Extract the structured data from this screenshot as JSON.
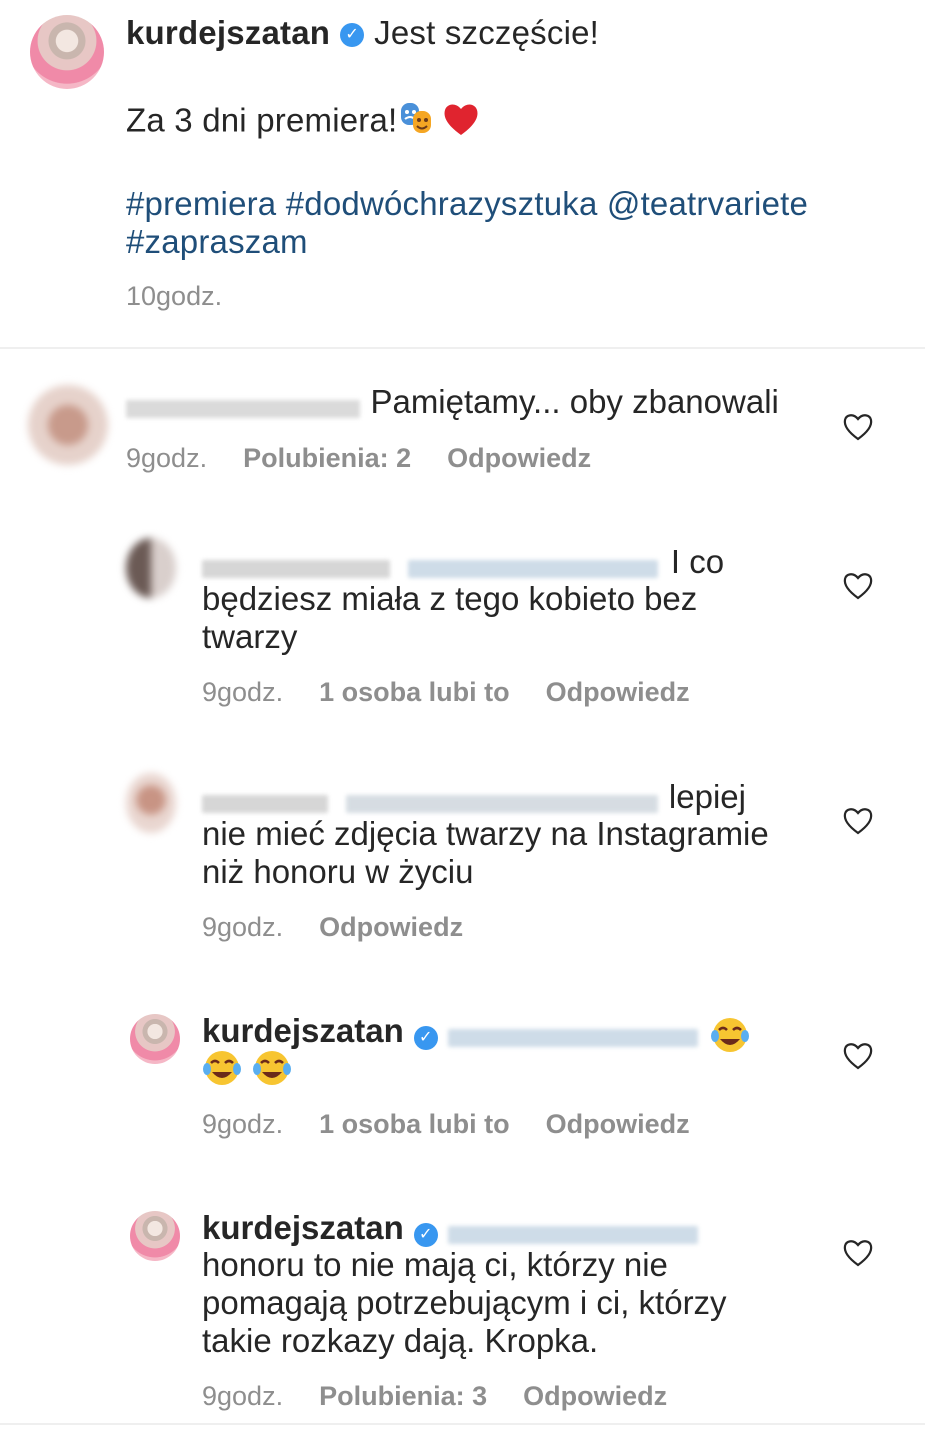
{
  "post": {
    "username": "kurdejszatan",
    "verified_icon": "check-icon",
    "caption_line1": "Jest szczęście!",
    "caption_line2": "Za 3 dni premiera!",
    "caption_emojis": [
      "performing-arts-emoji",
      "red-heart-emoji"
    ],
    "hashtags_line1": "#premiera #dodwóchrazysztuka @teatrvariete",
    "hashtags_line2": "#zapraszam",
    "time": "10godz."
  },
  "comments": [
    {
      "text": "Pamiętamy... oby zbanowali",
      "time": "9godz.",
      "likes": "Polubienia: 2",
      "reply": "Odpowiedz"
    },
    {
      "text_line1": "I co",
      "text_line2": "będziesz miała  z tego kobieto bez",
      "text_line3": "twarzy",
      "time": "9godz.",
      "likes": "1 osoba lubi to",
      "reply": "Odpowiedz"
    },
    {
      "text_line1": "lepiej",
      "text_line2": "nie mieć zdjęcia twarzy na Instagramie",
      "text_line3": "niż honoru w życiu",
      "time": "9godz.",
      "reply": "Odpowiedz"
    },
    {
      "username": "kurdejszatan",
      "emojis": [
        "face-with-tears-of-joy-emoji",
        "face-with-tears-of-joy-emoji",
        "face-with-tears-of-joy-emoji"
      ],
      "time": "9godz.",
      "likes": "1 osoba lubi to",
      "reply": "Odpowiedz"
    },
    {
      "username": "kurdejszatan",
      "text_line1": "honoru to nie mają ci, którzy nie",
      "text_line2": "pomagają potrzebującym i ci, którzy",
      "text_line3": "takie rozkazy dają. Kropka.",
      "time": "9godz.",
      "likes": "Polubienia: 3",
      "reply": "Odpowiedz"
    }
  ],
  "colors": {
    "link": "#1f4e79",
    "meta": "#8e8e8e",
    "verified": "#3897f0",
    "divider": "#efefef"
  }
}
